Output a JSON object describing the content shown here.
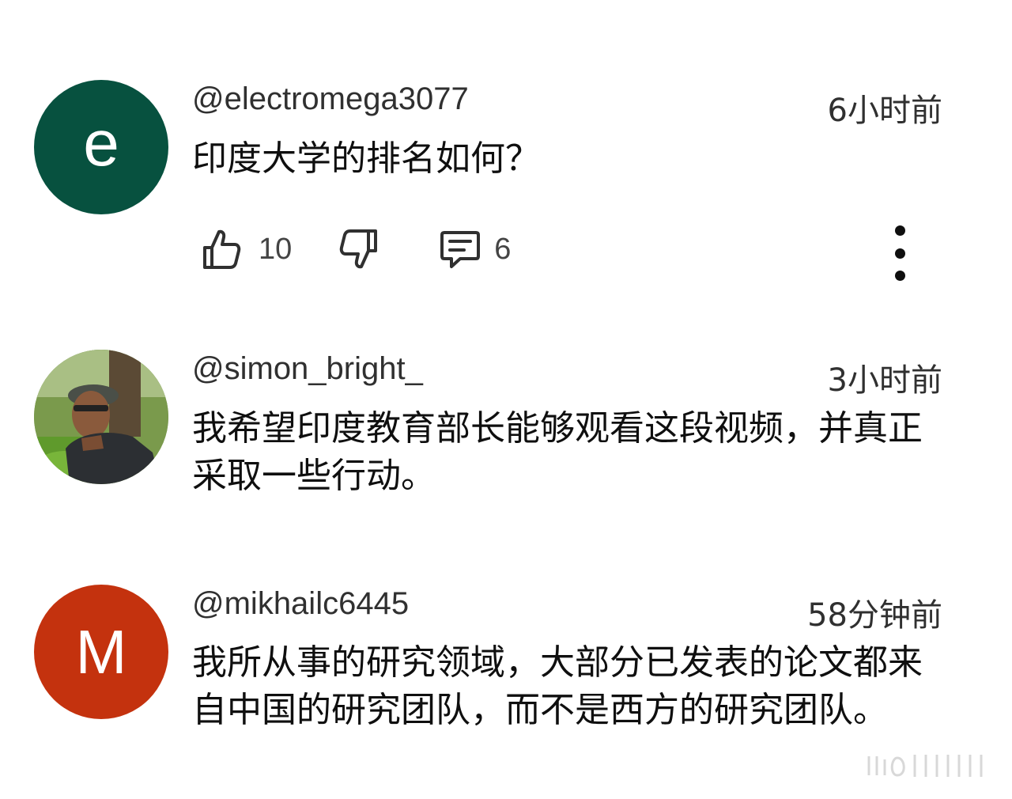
{
  "comments": [
    {
      "avatar": {
        "letter": "e",
        "color": "#07513f"
      },
      "handle": "@electromega3077",
      "time": "6小时前",
      "text": "印度大学的排名如何？",
      "likes": "10",
      "replies": "6",
      "icons": {
        "like": "thumbs-up-icon",
        "dislike": "thumbs-down-icon",
        "reply": "comment-icon",
        "more": "more-vertical-icon"
      }
    },
    {
      "avatar": {
        "letter": "",
        "color": "#5c7a3e"
      },
      "handle": "@simon_bright_",
      "time": "3小时前",
      "text": "我希望印度教育部长能够观看这段视频，并真正采取一些行动。"
    },
    {
      "avatar": {
        "letter": "M",
        "color": "#c4320e"
      },
      "handle": "@mikhailc6445",
      "time": "58分钟前",
      "text": "我所从事的研究领域，大部分已发表的论文都来自中国的研究团队，而不是西方的研究团队。"
    }
  ]
}
